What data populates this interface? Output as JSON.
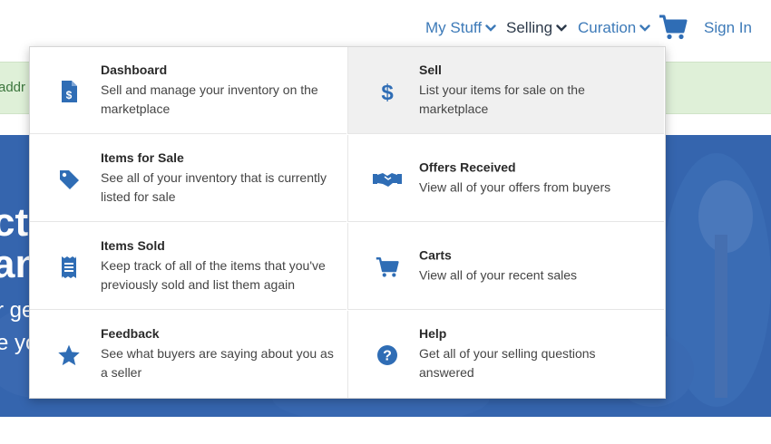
{
  "nav": {
    "my_stuff": "My Stuff",
    "selling": "Selling",
    "curation": "Curation",
    "sign_in": "Sign In",
    "cart_icon": "cart-icon"
  },
  "notice": {
    "text": "addr"
  },
  "hero": {
    "line1": "cto",
    "line2": "an",
    "sub1": "r ge",
    "sub2": "e yo"
  },
  "menu": {
    "left": [
      {
        "icon": "document-dollar-icon",
        "title": "Dashboard",
        "desc": "Sell and manage your inventory on the marketplace"
      },
      {
        "icon": "tag-icon",
        "title": "Items for Sale",
        "desc": "See all of your inventory that is currently listed for sale"
      },
      {
        "icon": "receipt-icon",
        "title": "Items Sold",
        "desc": "Keep track of all of the items that you've previously sold and list them again"
      },
      {
        "icon": "star-icon",
        "title": "Feedback",
        "desc": "See what buyers are saying about you as a seller"
      }
    ],
    "right": [
      {
        "icon": "dollar-icon",
        "title": "Sell",
        "desc": "List your items for sale on the marketplace"
      },
      {
        "icon": "handshake-icon",
        "title": "Offers Received",
        "desc": "View all of your offers from buyers"
      },
      {
        "icon": "cart-icon",
        "title": "Carts",
        "desc": "View all of your recent sales"
      },
      {
        "icon": "question-circle-icon",
        "title": "Help",
        "desc": "Get all of your selling questions answered"
      }
    ]
  },
  "colors": {
    "link": "#3d7ab8",
    "icon": "#2f6db5",
    "hero": "#3565ae",
    "notice": "#dff0d8"
  }
}
